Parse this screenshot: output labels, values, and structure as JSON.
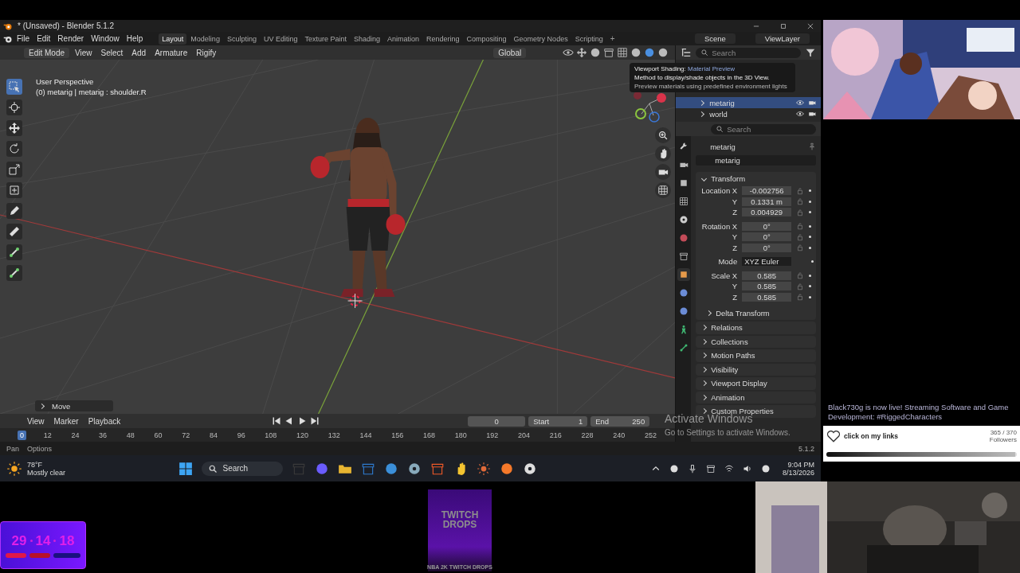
{
  "window": {
    "title": "* (Unsaved) - Blender 5.1.2"
  },
  "menu": [
    "File",
    "Edit",
    "Render",
    "Window",
    "Help"
  ],
  "workspaces": [
    {
      "label": "Layout",
      "selected": true
    },
    {
      "label": "Modeling",
      "selected": false
    },
    {
      "label": "Sculpting",
      "selected": false
    },
    {
      "label": "UV Editing",
      "selected": false
    },
    {
      "label": "Texture Paint",
      "selected": false
    },
    {
      "label": "Shading",
      "selected": false
    },
    {
      "label": "Animation",
      "selected": false
    },
    {
      "label": "Rendering",
      "selected": false
    },
    {
      "label": "Compositing",
      "selected": false
    },
    {
      "label": "Geometry Nodes",
      "selected": false
    },
    {
      "label": "Scripting",
      "selected": false
    }
  ],
  "add_workspace": "+",
  "scene": "Scene",
  "view_layer": "ViewLayer",
  "viewport_header": {
    "mode": "Edit Mode",
    "menus": [
      "View",
      "Select",
      "Add",
      "Armature",
      "Rigify"
    ],
    "orientation": "Global"
  },
  "viewport": {
    "perspective": "User Perspective",
    "active": "(0) metarig | metarig : shoulder.R",
    "last_operator": "Move"
  },
  "tooltip": {
    "title": "Viewport Shading:",
    "value": "Material Preview",
    "lines": [
      "Method to display/shade objects in the 3D View.",
      "Preview materials using predefined environment lights"
    ]
  },
  "outliner": {
    "search_placeholder": "Search",
    "items": [
      {
        "name": "metarig",
        "selected": true
      },
      {
        "name": "world",
        "selected": false
      }
    ]
  },
  "properties": {
    "search_placeholder": "Search",
    "object_name": "metarig",
    "data_name": "metarig",
    "transform": {
      "title": "Transform",
      "expanded": true,
      "rows": [
        {
          "kind": "field",
          "label": "Location X",
          "value": "-0.002756"
        },
        {
          "kind": "field",
          "label": "Y",
          "value": "0.1331 m"
        },
        {
          "kind": "field",
          "label": "Z",
          "value": "0.004929"
        },
        {
          "kind": "field",
          "label": "Rotation X",
          "value": "0°"
        },
        {
          "kind": "field",
          "label": "Y",
          "value": "0°"
        },
        {
          "kind": "field",
          "label": "Z",
          "value": "0°"
        },
        {
          "kind": "select",
          "label": "Mode",
          "value": "XYZ Euler"
        },
        {
          "kind": "field",
          "label": "Scale X",
          "value": "0.585"
        },
        {
          "kind": "field",
          "label": "Y",
          "value": "0.585"
        },
        {
          "kind": "field",
          "label": "Z",
          "value": "0.585"
        }
      ],
      "sub": {
        "title": "Delta Transform",
        "expanded": false
      }
    },
    "sections": [
      {
        "title": "Relations",
        "expanded": false
      },
      {
        "title": "Collections",
        "expanded": false
      },
      {
        "title": "Motion Paths",
        "expanded": false
      },
      {
        "title": "Visibility",
        "expanded": false
      },
      {
        "title": "Viewport Display",
        "expanded": false
      },
      {
        "title": "Animation",
        "expanded": false
      },
      {
        "title": "Custom Properties",
        "expanded": false
      }
    ]
  },
  "timeline": {
    "menus": [
      "View",
      "Marker",
      "Playback"
    ],
    "current_frame": "0",
    "start_label": "Start",
    "start": "1",
    "end_label": "End",
    "end": "250",
    "frames": [
      {
        "label": "0",
        "selected": true
      },
      {
        "label": "12",
        "selected": false
      },
      {
        "label": "24",
        "selected": false
      },
      {
        "label": "36",
        "selected": false
      },
      {
        "label": "48",
        "selected": false
      },
      {
        "label": "60",
        "selected": false
      },
      {
        "label": "72",
        "selected": false
      },
      {
        "label": "84",
        "selected": false
      },
      {
        "label": "96",
        "selected": false
      },
      {
        "label": "108",
        "selected": false
      },
      {
        "label": "120",
        "selected": false
      },
      {
        "label": "132",
        "selected": false
      },
      {
        "label": "144",
        "selected": false
      },
      {
        "label": "156",
        "selected": false
      },
      {
        "label": "168",
        "selected": false
      },
      {
        "label": "180",
        "selected": false
      },
      {
        "label": "192",
        "selected": false
      },
      {
        "label": "204",
        "selected": false
      },
      {
        "label": "216",
        "selected": false
      },
      {
        "label": "228",
        "selected": false
      },
      {
        "label": "240",
        "selected": false
      },
      {
        "label": "252",
        "selected": false
      }
    ]
  },
  "status_bar": {
    "items": [
      "Pan",
      "Options"
    ],
    "version": "5.1.2"
  },
  "activation_notice": {
    "title": "Activate Windows",
    "text": "Go to Settings to activate Windows."
  },
  "taskbar": {
    "temperature": "78°F",
    "weather": "Mostly clear",
    "search": "Search",
    "time": "9:04 PM",
    "date": "8/13/2026"
  },
  "stream_alert": {
    "message": "Black730g is now live! Streaming Software and Game Development: #RiggedCharacters"
  },
  "follower_goal": {
    "label": "click on my links",
    "count": "365 / 370",
    "unit": "Followers",
    "level": 0.99
  },
  "clock": {
    "digits": [
      "29",
      "14",
      "18"
    ]
  },
  "drops": {
    "title": "TWITCH DROPS",
    "caption": "NBA 2K TWITCH DROPS"
  }
}
